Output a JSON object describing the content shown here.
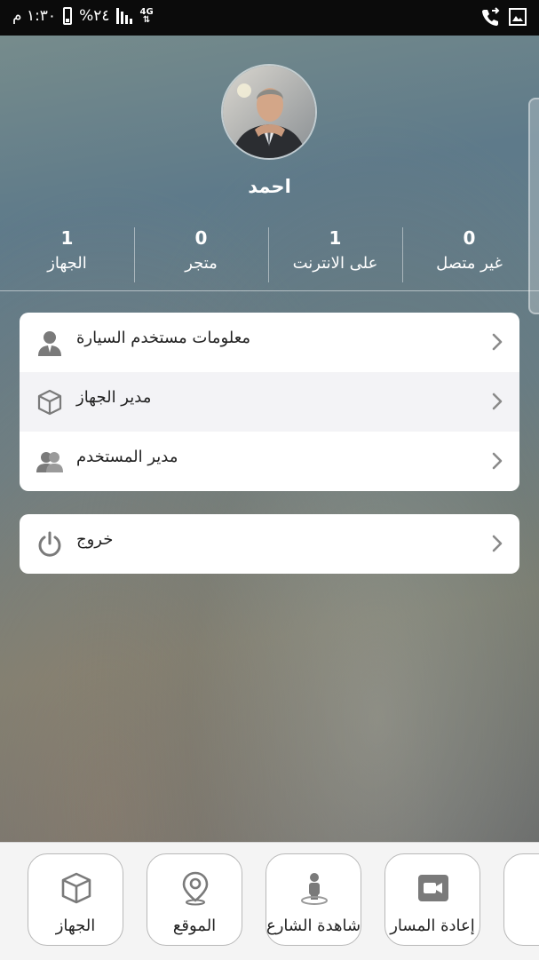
{
  "status_bar": {
    "time": "١:٣٠ م",
    "battery_percent": "%٢٤",
    "network": "4G"
  },
  "profile": {
    "name": "احمد"
  },
  "stats": [
    {
      "value": "0",
      "label": "غير متصل"
    },
    {
      "value": "1",
      "label": "على الانترنت"
    },
    {
      "value": "0",
      "label": "متجر"
    },
    {
      "value": "1",
      "label": "الجهاز"
    }
  ],
  "menu": [
    {
      "label": "معلومات مستخدم السيارة",
      "icon": "user-icon"
    },
    {
      "label": "مدير الجهاز",
      "icon": "cube-icon"
    },
    {
      "label": "مدير المستخدم",
      "icon": "users-icon"
    }
  ],
  "logout": {
    "label": "خروج",
    "icon": "power-icon"
  },
  "bottom_tabs": [
    {
      "label": "الجهاز",
      "icon": "cube-icon"
    },
    {
      "label": "الموقع",
      "icon": "location-pin-icon"
    },
    {
      "label": "شاهدة الشارع",
      "icon": "street-view-icon"
    },
    {
      "label": "إعادة المسار",
      "icon": "video-camera-icon"
    }
  ]
}
